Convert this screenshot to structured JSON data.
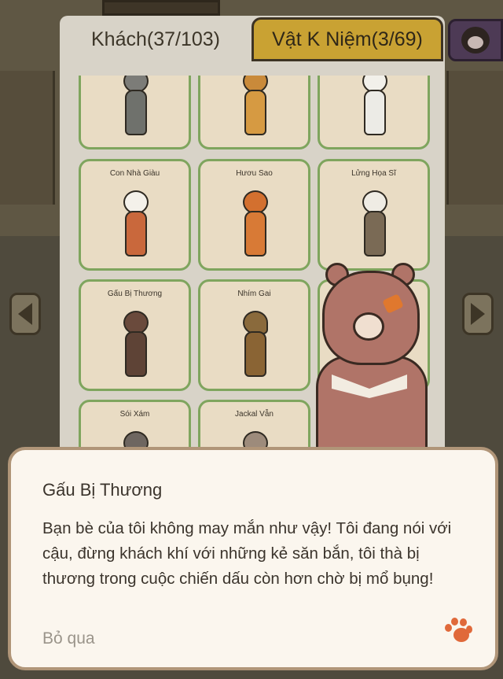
{
  "tabs": {
    "guests": "Khách(37/103)",
    "souvenirs": "Vật K Niệm(3/69)"
  },
  "cards": [
    {
      "name": ""
    },
    {
      "name": ""
    },
    {
      "name": ""
    },
    {
      "name": "Con Nhà Giàu"
    },
    {
      "name": "Hươu Sao"
    },
    {
      "name": "Lửng Họa Sĩ"
    },
    {
      "name": "Gấu Bị Thương"
    },
    {
      "name": "Nhím Gai"
    },
    {
      "name": ""
    },
    {
      "name": "Sói Xám"
    },
    {
      "name": "Jackal Vẫn"
    }
  ],
  "dialog": {
    "speaker": "Gấu Bị Thương",
    "message": "Bạn bè của tôi không may mắn như vậy! Tôi đang nói với cậu, đừng khách khí với những kẻ săn bắn, tôi thà bị thương trong cuộc chiến dấu còn hơn chờ bị mổ bụng!",
    "skip": "Bỏ qua"
  },
  "icons": {
    "nav_left": "chevron-left-icon",
    "nav_right": "chevron-right-icon",
    "continue": "paw-icon",
    "monkey": "monkey-icon"
  },
  "colors": {
    "card_border": "#7fa55e",
    "tab_inactive": "#c9a233",
    "paw": "#e0693a"
  }
}
